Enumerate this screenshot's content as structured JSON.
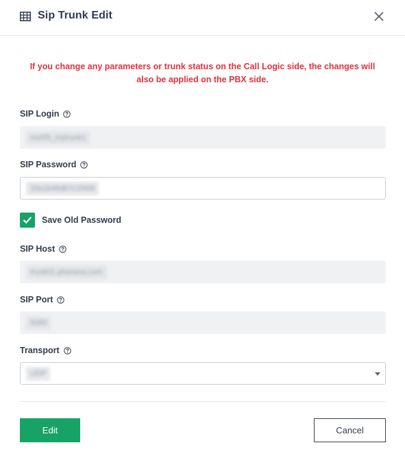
{
  "dialog": {
    "title": "Sip Trunk Edit",
    "title_icon": "table-icon",
    "close_icon": "close-icon"
  },
  "warning": "If you change any parameters or trunk status on the Call Logic side, the changes will also be applied on the PBX side.",
  "fields": {
    "sip_login": {
      "label": "SIP Login",
      "value": "mol35_mytrunk1",
      "disabled": true
    },
    "sip_password": {
      "label": "SIP Password",
      "value": "33a1b48db7c1f468",
      "disabled": false
    },
    "save_old_password": {
      "label": "Save Old Password",
      "checked": true
    },
    "sip_host": {
      "label": "SIP Host",
      "value": "trunk01.phonesa.com",
      "disabled": true
    },
    "sip_port": {
      "label": "SIP Port",
      "value": "5060",
      "disabled": true
    },
    "transport": {
      "label": "Transport",
      "value": "UDP"
    }
  },
  "buttons": {
    "edit": "Edit",
    "cancel": "Cancel"
  },
  "colors": {
    "accent": "#17a266",
    "warning": "#e0323c"
  }
}
